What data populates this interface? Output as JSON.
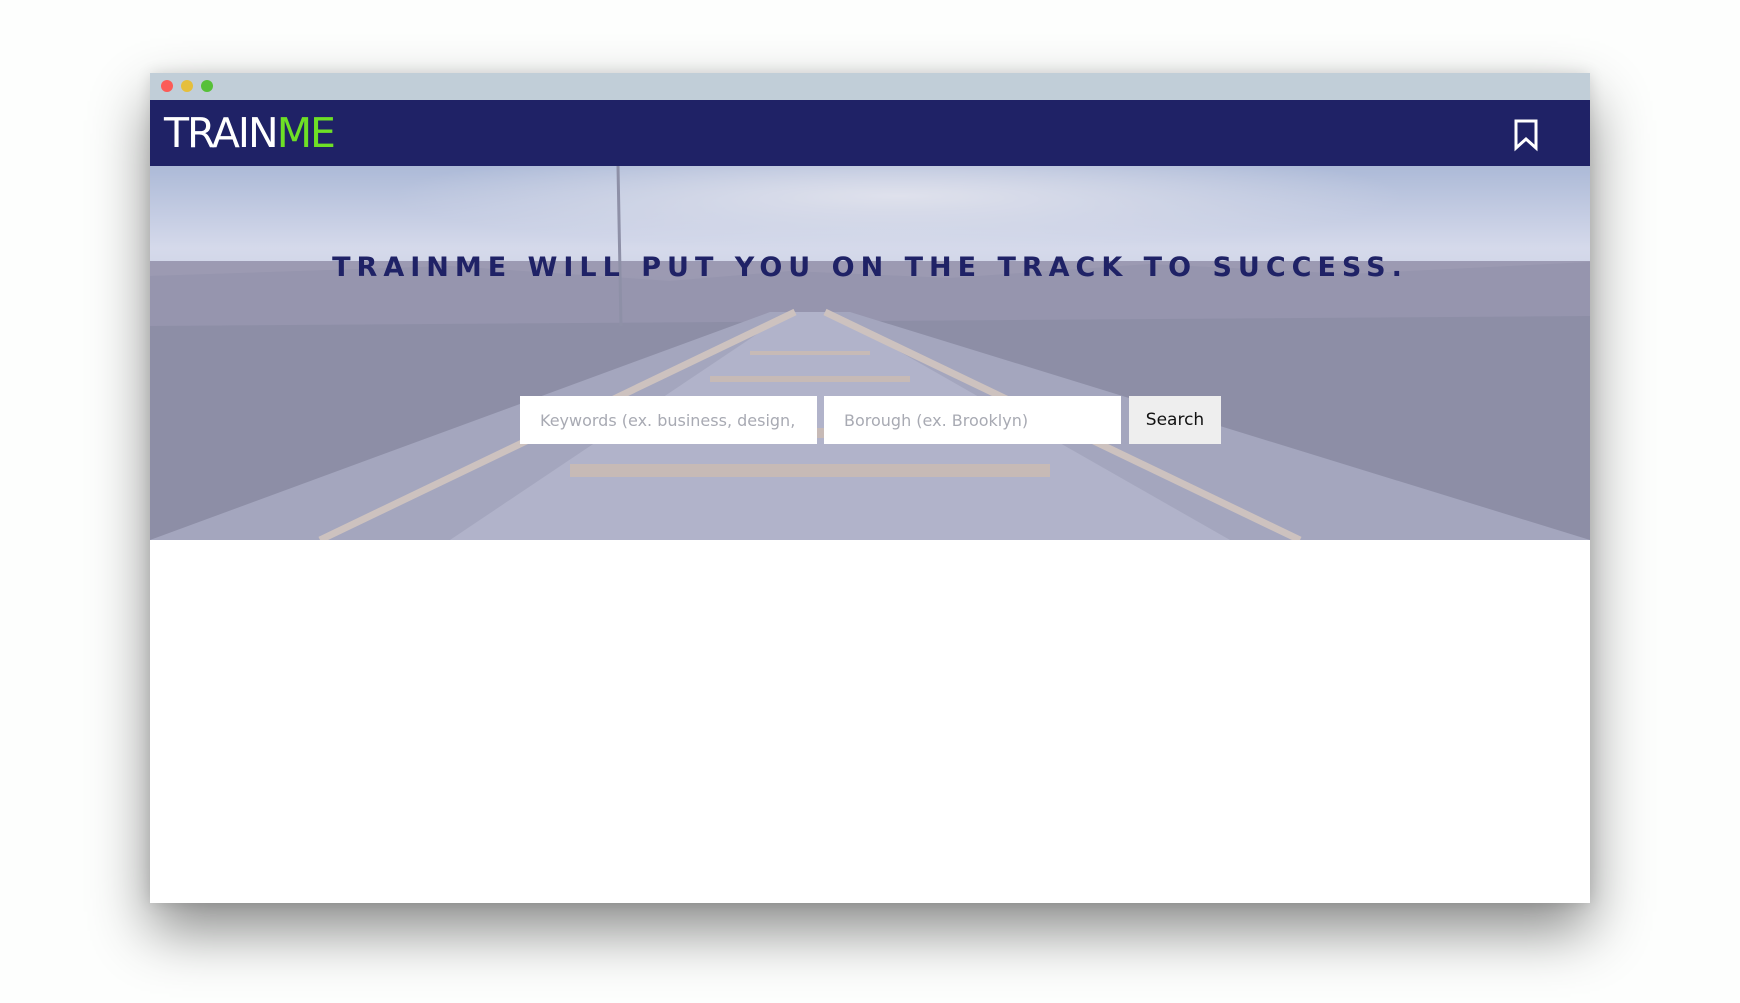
{
  "window": {
    "controls": [
      "close",
      "minimize",
      "zoom"
    ]
  },
  "header": {
    "logo": {
      "part1": "TRAIN",
      "part2": "ME"
    },
    "bookmark_icon": "bookmark-icon"
  },
  "hero": {
    "tagline": "TRAINME WILL PUT YOU ON THE TRACK TO SUCCESS.",
    "search": {
      "keywords_placeholder": "Keywords (ex. business, design, health)",
      "keywords_value": "",
      "borough_placeholder": "Borough (ex. Brooklyn)",
      "borough_value": "",
      "button_label": "Search"
    }
  },
  "colors": {
    "nav_bg": "#1f2266",
    "logo_accent": "#6ee026",
    "tagline": "#1f2266",
    "dot_red": "#fc5b57",
    "dot_yellow": "#e5bf3c",
    "dot_green": "#57c038"
  }
}
